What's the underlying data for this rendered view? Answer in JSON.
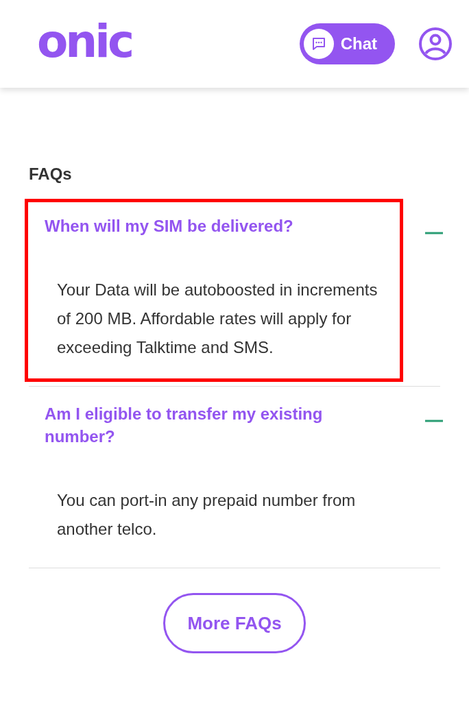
{
  "header": {
    "logo": "onic",
    "chat_button": "Chat"
  },
  "section_title": "FAQs",
  "faqs": [
    {
      "question": "When will my SIM be delivered?",
      "answer": "Your Data will be autoboosted in increments of 200 MB. Affordable rates will apply for exceeding Talktime and SMS.",
      "expanded": true,
      "highlighted": true
    },
    {
      "question": "Am I eligible to transfer my existing number?",
      "answer": "You can port-in any prepaid number from another telco.",
      "expanded": true,
      "highlighted": false
    }
  ],
  "more_button": "More FAQs"
}
